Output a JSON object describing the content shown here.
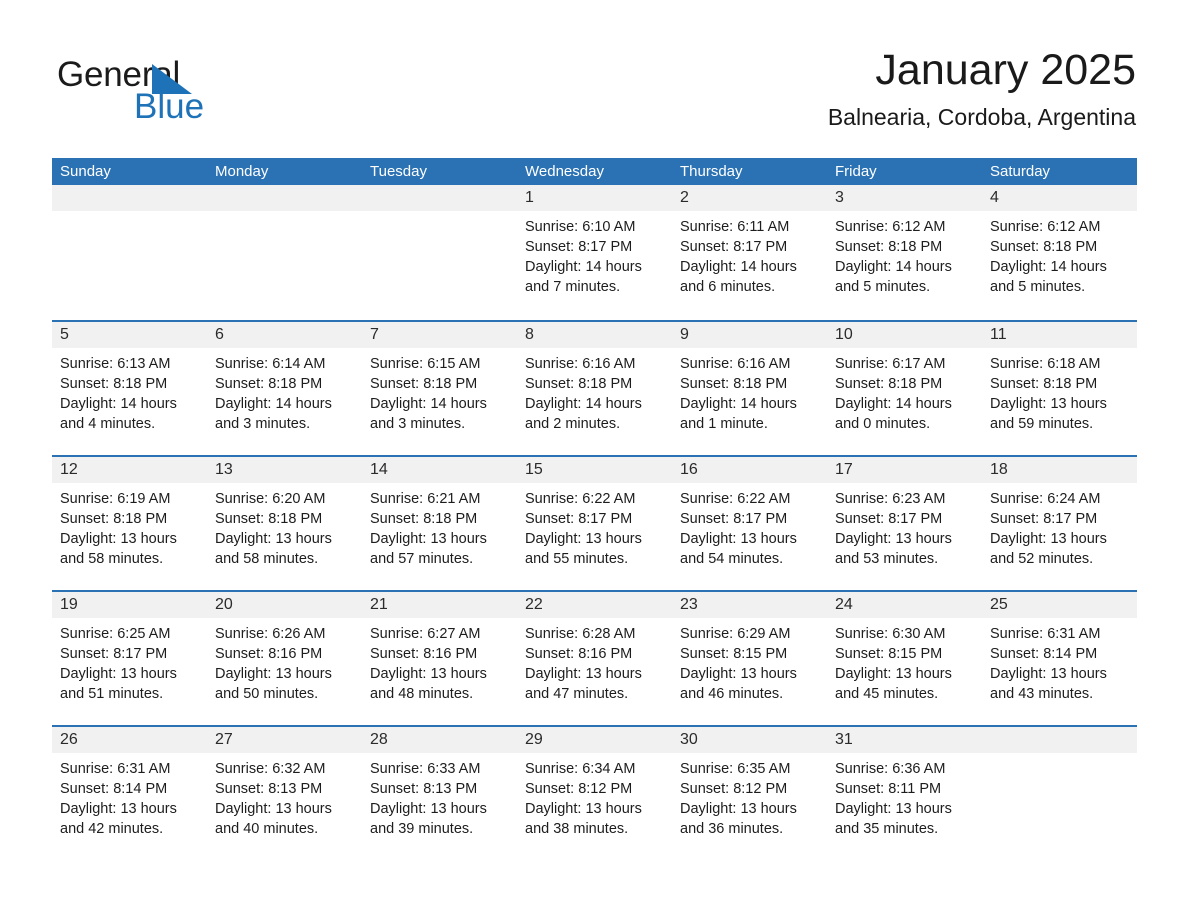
{
  "brand": {
    "name_part1": "General",
    "name_part2": "Blue",
    "accent_color": "#1e73b8"
  },
  "header": {
    "title": "January 2025",
    "location": "Balnearia, Cordoba, Argentina"
  },
  "theme": {
    "header_blue": "#2b72b4",
    "day_band_gray": "#f1f1f1",
    "text_color": "#1d1d1d"
  },
  "calendar": {
    "weekday_headers": [
      "Sunday",
      "Monday",
      "Tuesday",
      "Wednesday",
      "Thursday",
      "Friday",
      "Saturday"
    ],
    "weeks": [
      [
        {
          "day": "",
          "sunrise": "",
          "sunset": "",
          "daylight1": "",
          "daylight2": ""
        },
        {
          "day": "",
          "sunrise": "",
          "sunset": "",
          "daylight1": "",
          "daylight2": ""
        },
        {
          "day": "",
          "sunrise": "",
          "sunset": "",
          "daylight1": "",
          "daylight2": ""
        },
        {
          "day": "1",
          "sunrise": "Sunrise: 6:10 AM",
          "sunset": "Sunset: 8:17 PM",
          "daylight1": "Daylight: 14 hours",
          "daylight2": "and 7 minutes."
        },
        {
          "day": "2",
          "sunrise": "Sunrise: 6:11 AM",
          "sunset": "Sunset: 8:17 PM",
          "daylight1": "Daylight: 14 hours",
          "daylight2": "and 6 minutes."
        },
        {
          "day": "3",
          "sunrise": "Sunrise: 6:12 AM",
          "sunset": "Sunset: 8:18 PM",
          "daylight1": "Daylight: 14 hours",
          "daylight2": "and 5 minutes."
        },
        {
          "day": "4",
          "sunrise": "Sunrise: 6:12 AM",
          "sunset": "Sunset: 8:18 PM",
          "daylight1": "Daylight: 14 hours",
          "daylight2": "and 5 minutes."
        }
      ],
      [
        {
          "day": "5",
          "sunrise": "Sunrise: 6:13 AM",
          "sunset": "Sunset: 8:18 PM",
          "daylight1": "Daylight: 14 hours",
          "daylight2": "and 4 minutes."
        },
        {
          "day": "6",
          "sunrise": "Sunrise: 6:14 AM",
          "sunset": "Sunset: 8:18 PM",
          "daylight1": "Daylight: 14 hours",
          "daylight2": "and 3 minutes."
        },
        {
          "day": "7",
          "sunrise": "Sunrise: 6:15 AM",
          "sunset": "Sunset: 8:18 PM",
          "daylight1": "Daylight: 14 hours",
          "daylight2": "and 3 minutes."
        },
        {
          "day": "8",
          "sunrise": "Sunrise: 6:16 AM",
          "sunset": "Sunset: 8:18 PM",
          "daylight1": "Daylight: 14 hours",
          "daylight2": "and 2 minutes."
        },
        {
          "day": "9",
          "sunrise": "Sunrise: 6:16 AM",
          "sunset": "Sunset: 8:18 PM",
          "daylight1": "Daylight: 14 hours",
          "daylight2": "and 1 minute."
        },
        {
          "day": "10",
          "sunrise": "Sunrise: 6:17 AM",
          "sunset": "Sunset: 8:18 PM",
          "daylight1": "Daylight: 14 hours",
          "daylight2": "and 0 minutes."
        },
        {
          "day": "11",
          "sunrise": "Sunrise: 6:18 AM",
          "sunset": "Sunset: 8:18 PM",
          "daylight1": "Daylight: 13 hours",
          "daylight2": "and 59 minutes."
        }
      ],
      [
        {
          "day": "12",
          "sunrise": "Sunrise: 6:19 AM",
          "sunset": "Sunset: 8:18 PM",
          "daylight1": "Daylight: 13 hours",
          "daylight2": "and 58 minutes."
        },
        {
          "day": "13",
          "sunrise": "Sunrise: 6:20 AM",
          "sunset": "Sunset: 8:18 PM",
          "daylight1": "Daylight: 13 hours",
          "daylight2": "and 58 minutes."
        },
        {
          "day": "14",
          "sunrise": "Sunrise: 6:21 AM",
          "sunset": "Sunset: 8:18 PM",
          "daylight1": "Daylight: 13 hours",
          "daylight2": "and 57 minutes."
        },
        {
          "day": "15",
          "sunrise": "Sunrise: 6:22 AM",
          "sunset": "Sunset: 8:17 PM",
          "daylight1": "Daylight: 13 hours",
          "daylight2": "and 55 minutes."
        },
        {
          "day": "16",
          "sunrise": "Sunrise: 6:22 AM",
          "sunset": "Sunset: 8:17 PM",
          "daylight1": "Daylight: 13 hours",
          "daylight2": "and 54 minutes."
        },
        {
          "day": "17",
          "sunrise": "Sunrise: 6:23 AM",
          "sunset": "Sunset: 8:17 PM",
          "daylight1": "Daylight: 13 hours",
          "daylight2": "and 53 minutes."
        },
        {
          "day": "18",
          "sunrise": "Sunrise: 6:24 AM",
          "sunset": "Sunset: 8:17 PM",
          "daylight1": "Daylight: 13 hours",
          "daylight2": "and 52 minutes."
        }
      ],
      [
        {
          "day": "19",
          "sunrise": "Sunrise: 6:25 AM",
          "sunset": "Sunset: 8:17 PM",
          "daylight1": "Daylight: 13 hours",
          "daylight2": "and 51 minutes."
        },
        {
          "day": "20",
          "sunrise": "Sunrise: 6:26 AM",
          "sunset": "Sunset: 8:16 PM",
          "daylight1": "Daylight: 13 hours",
          "daylight2": "and 50 minutes."
        },
        {
          "day": "21",
          "sunrise": "Sunrise: 6:27 AM",
          "sunset": "Sunset: 8:16 PM",
          "daylight1": "Daylight: 13 hours",
          "daylight2": "and 48 minutes."
        },
        {
          "day": "22",
          "sunrise": "Sunrise: 6:28 AM",
          "sunset": "Sunset: 8:16 PM",
          "daylight1": "Daylight: 13 hours",
          "daylight2": "and 47 minutes."
        },
        {
          "day": "23",
          "sunrise": "Sunrise: 6:29 AM",
          "sunset": "Sunset: 8:15 PM",
          "daylight1": "Daylight: 13 hours",
          "daylight2": "and 46 minutes."
        },
        {
          "day": "24",
          "sunrise": "Sunrise: 6:30 AM",
          "sunset": "Sunset: 8:15 PM",
          "daylight1": "Daylight: 13 hours",
          "daylight2": "and 45 minutes."
        },
        {
          "day": "25",
          "sunrise": "Sunrise: 6:31 AM",
          "sunset": "Sunset: 8:14 PM",
          "daylight1": "Daylight: 13 hours",
          "daylight2": "and 43 minutes."
        }
      ],
      [
        {
          "day": "26",
          "sunrise": "Sunrise: 6:31 AM",
          "sunset": "Sunset: 8:14 PM",
          "daylight1": "Daylight: 13 hours",
          "daylight2": "and 42 minutes."
        },
        {
          "day": "27",
          "sunrise": "Sunrise: 6:32 AM",
          "sunset": "Sunset: 8:13 PM",
          "daylight1": "Daylight: 13 hours",
          "daylight2": "and 40 minutes."
        },
        {
          "day": "28",
          "sunrise": "Sunrise: 6:33 AM",
          "sunset": "Sunset: 8:13 PM",
          "daylight1": "Daylight: 13 hours",
          "daylight2": "and 39 minutes."
        },
        {
          "day": "29",
          "sunrise": "Sunrise: 6:34 AM",
          "sunset": "Sunset: 8:12 PM",
          "daylight1": "Daylight: 13 hours",
          "daylight2": "and 38 minutes."
        },
        {
          "day": "30",
          "sunrise": "Sunrise: 6:35 AM",
          "sunset": "Sunset: 8:12 PM",
          "daylight1": "Daylight: 13 hours",
          "daylight2": "and 36 minutes."
        },
        {
          "day": "31",
          "sunrise": "Sunrise: 6:36 AM",
          "sunset": "Sunset: 8:11 PM",
          "daylight1": "Daylight: 13 hours",
          "daylight2": "and 35 minutes."
        },
        {
          "day": "",
          "sunrise": "",
          "sunset": "",
          "daylight1": "",
          "daylight2": ""
        }
      ]
    ]
  }
}
